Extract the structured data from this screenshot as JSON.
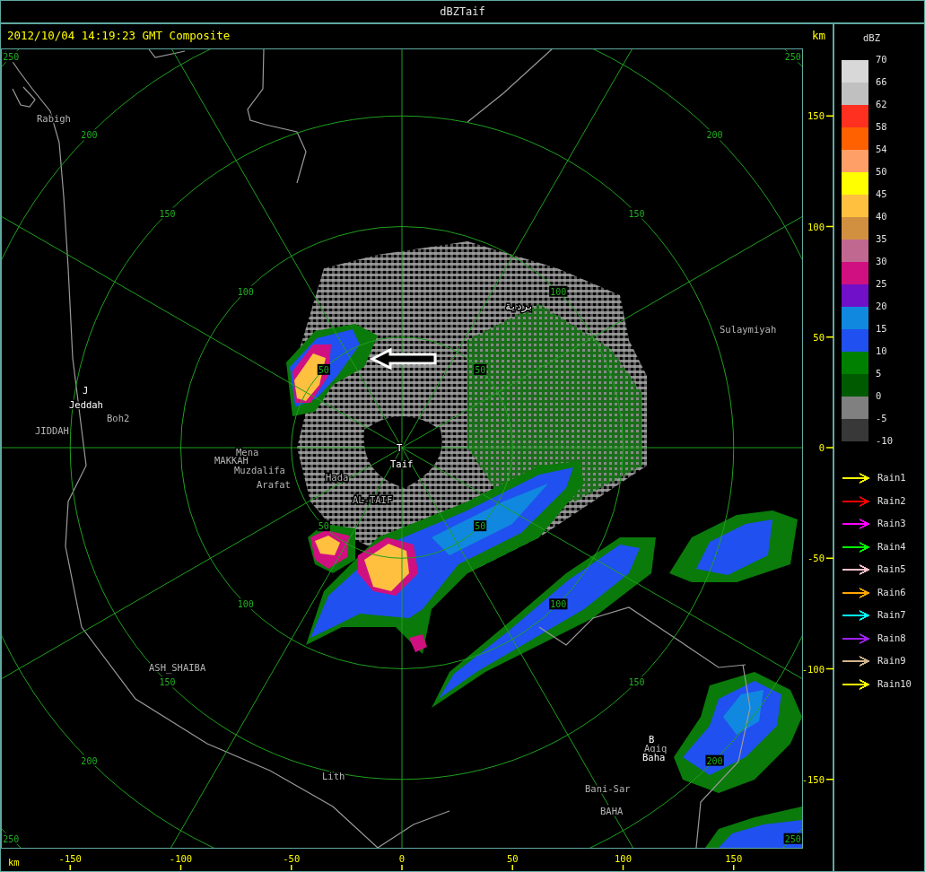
{
  "window": {
    "title": "dBZTaif"
  },
  "header": {
    "timestamp": "2012/10/04 14:19:23 GMT Composite",
    "unit": "km"
  },
  "map": {
    "range_rings": [
      {
        "labels": [
          "50",
          "50",
          "50",
          "50"
        ]
      },
      {
        "labels": [
          "100",
          "100",
          "100",
          "100"
        ]
      },
      {
        "labels": [
          "150",
          "150",
          "150",
          "150"
        ]
      },
      {
        "labels": [
          "200",
          "200",
          "200",
          "200"
        ]
      },
      {
        "labels": [
          "250",
          "250",
          "250",
          "250"
        ]
      }
    ],
    "places": [
      {
        "name": "Rabigh",
        "kind": "site"
      },
      {
        "name": "J",
        "kind": "city"
      },
      {
        "name": "Jeddah",
        "kind": "city"
      },
      {
        "name": "Boh2",
        "kind": "site"
      },
      {
        "name": "JIDDAH",
        "kind": "site"
      },
      {
        "name": "MAKKAH",
        "kind": "site"
      },
      {
        "name": "Mena",
        "kind": "site"
      },
      {
        "name": "Muzdalifa",
        "kind": "site"
      },
      {
        "name": "Arafat",
        "kind": "site"
      },
      {
        "name": "Hada",
        "kind": "site"
      },
      {
        "name": "AL-TAIF",
        "kind": "site"
      },
      {
        "name": "T",
        "kind": "city"
      },
      {
        "name": "Taif",
        "kind": "city"
      },
      {
        "name": "بردية",
        "kind": "city"
      },
      {
        "name": "Sulaymiyah",
        "kind": "site"
      },
      {
        "name": "ASH_SHAIBA",
        "kind": "site"
      },
      {
        "name": "Lith",
        "kind": "site"
      },
      {
        "name": "B",
        "kind": "city"
      },
      {
        "name": "Aqiq",
        "kind": "site"
      },
      {
        "name": "Baha",
        "kind": "city"
      },
      {
        "name": "Bani-Sar",
        "kind": "site"
      },
      {
        "name": "BAHA",
        "kind": "site"
      }
    ]
  },
  "y_axis": {
    "ticks": [
      "150",
      "100",
      "50",
      "0",
      "-50",
      "-100",
      "-150"
    ]
  },
  "x_axis": {
    "unit": "km",
    "ticks": [
      "-150",
      "-100",
      "-50",
      "0",
      "50",
      "100",
      "150"
    ]
  },
  "legend": {
    "title": "dBZ",
    "labels": [
      "70",
      "66",
      "62",
      "58",
      "54",
      "50",
      "45",
      "40",
      "35",
      "30",
      "25",
      "20",
      "15",
      "10",
      "5",
      "0",
      "-5",
      "-10"
    ],
    "bins": [
      {
        "color": "#d8d8d8"
      },
      {
        "color": "#c0c0c0"
      },
      {
        "color": "#ff3020"
      },
      {
        "color": "#ff6000"
      },
      {
        "color": "#ff9f68"
      },
      {
        "color": "#ffff00"
      },
      {
        "color": "#ffc040"
      },
      {
        "color": "#d09040"
      },
      {
        "color": "#c06890"
      },
      {
        "color": "#d01080"
      },
      {
        "color": "#7010c8"
      },
      {
        "color": "#1088e0"
      },
      {
        "color": "#2050f0"
      },
      {
        "color": "#008000"
      },
      {
        "color": "#005a00"
      },
      {
        "color": "#808080"
      },
      {
        "color": "#383838"
      }
    ],
    "arrows": [
      {
        "label": "Rain1",
        "color": "#ffff00"
      },
      {
        "label": "Rain2",
        "color": "#ff0000"
      },
      {
        "label": "Rain3",
        "color": "#ff00ff"
      },
      {
        "label": "Rain4",
        "color": "#00ff00"
      },
      {
        "label": "Rain5",
        "color": "#ffc0cb"
      },
      {
        "label": "Rain6",
        "color": "#ffa500"
      },
      {
        "label": "Rain7",
        "color": "#00ffff"
      },
      {
        "label": "Rain8",
        "color": "#a020f0"
      },
      {
        "label": "Rain9",
        "color": "#d2b48c"
      },
      {
        "label": "Rain10",
        "color": "#ffff00"
      }
    ]
  }
}
